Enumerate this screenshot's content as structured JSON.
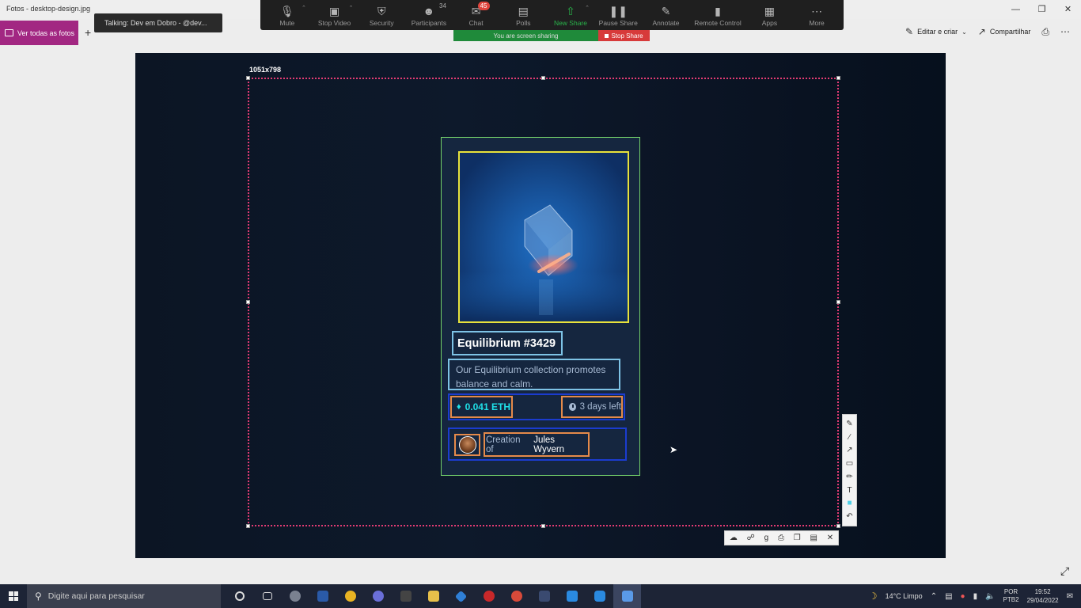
{
  "app": {
    "title": "Fotos - desktop-design.jpg",
    "view_all_label": "Ver todas as fotos",
    "add_label": "+",
    "edit_create_label": "Editar e criar",
    "share_label": "Compartilhar"
  },
  "talking": {
    "text": "Talking: Dev em Dobro - @dev..."
  },
  "zoom": {
    "buttons": [
      {
        "label": "Mute",
        "icon": "microphone-icon"
      },
      {
        "label": "Stop Video",
        "icon": "video-camera-icon"
      },
      {
        "label": "Security",
        "icon": "shield-icon"
      },
      {
        "label": "Participants",
        "icon": "participants-icon",
        "count": "34"
      },
      {
        "label": "Chat",
        "icon": "chat-icon",
        "badge": "45"
      },
      {
        "label": "Polls",
        "icon": "polls-icon"
      },
      {
        "label": "New Share",
        "icon": "share-screen-icon"
      },
      {
        "label": "Pause Share",
        "icon": "pause-icon"
      },
      {
        "label": "Annotate",
        "icon": "pen-icon"
      },
      {
        "label": "Remote Control",
        "icon": "mouse-icon"
      },
      {
        "label": "Apps",
        "icon": "apps-icon"
      },
      {
        "label": "More",
        "icon": "more-icon"
      }
    ],
    "sharing_text": "You are screen sharing",
    "stop_share_label": "Stop Share"
  },
  "photo": {
    "selection_size": "1051x798",
    "card": {
      "title": "Equilibrium #3429",
      "description": "Our Equilibrium collection promotes balance and calm.",
      "price": "0.041 ETH",
      "time_left": "3 days left",
      "creation_prefix": "Creation of",
      "author": "Jules Wyvern"
    }
  },
  "taskbar": {
    "search_placeholder": "Digite aqui para pesquisar",
    "weather": "14°C  Limpo",
    "lang_line1": "POR",
    "lang_line2": "PTB2",
    "time": "19:52",
    "date": "29/04/2022"
  },
  "colors": {
    "accent_purple": "#a22782",
    "zoom_green": "#29b34a",
    "stop_red": "#d73a3a",
    "eth_cyan": "#1fe0e8",
    "selection_pink": "#e23b73"
  }
}
